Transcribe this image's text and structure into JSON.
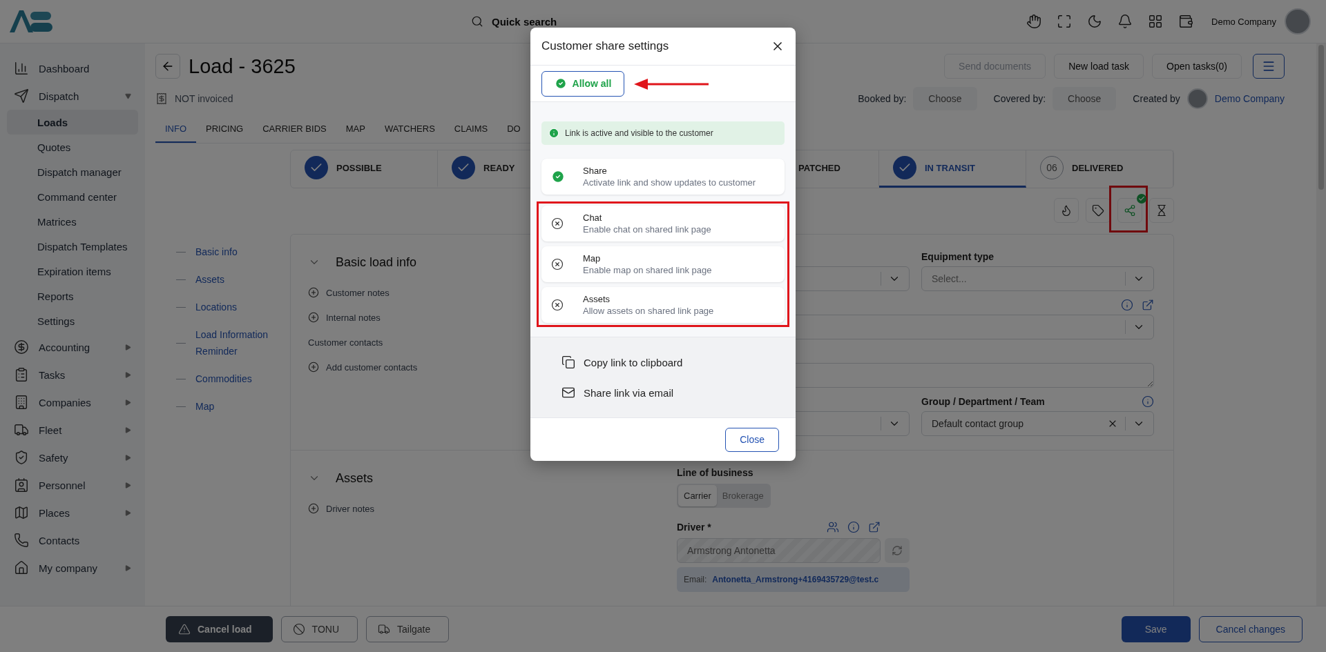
{
  "header": {
    "search_placeholder": "Quick search",
    "company": "Demo Company"
  },
  "sidebar": {
    "items": [
      {
        "label": "Dashboard",
        "kind": "link"
      },
      {
        "label": "Dispatch",
        "kind": "menu",
        "expanded": true,
        "children": [
          {
            "label": "Loads",
            "selected": true
          },
          {
            "label": "Quotes",
            "selected": false
          },
          {
            "label": "Dispatch manager",
            "selected": false
          },
          {
            "label": "Command center",
            "selected": false
          },
          {
            "label": "Matrices",
            "selected": false
          },
          {
            "label": "Dispatch Templates",
            "selected": false
          },
          {
            "label": "Expiration items",
            "selected": false
          },
          {
            "label": "Reports",
            "selected": false
          },
          {
            "label": "Settings",
            "selected": false
          }
        ]
      },
      {
        "label": "Accounting",
        "kind": "menu",
        "expanded": false
      },
      {
        "label": "Tasks",
        "kind": "menu",
        "expanded": false
      },
      {
        "label": "Companies",
        "kind": "menu",
        "expanded": false
      },
      {
        "label": "Fleet",
        "kind": "menu",
        "expanded": false
      },
      {
        "label": "Safety",
        "kind": "menu",
        "expanded": false
      },
      {
        "label": "Personnel",
        "kind": "menu",
        "expanded": false
      },
      {
        "label": "Places",
        "kind": "menu",
        "expanded": false
      },
      {
        "label": "Contacts",
        "kind": "link"
      },
      {
        "label": "My company",
        "kind": "menu",
        "expanded": false
      }
    ]
  },
  "page": {
    "title": "Load - 3625",
    "actions": [
      {
        "label": "Send documents",
        "disabled": true
      },
      {
        "label": "New load task",
        "disabled": false
      },
      {
        "label": "Open tasks(0)",
        "disabled": false
      }
    ],
    "invoice_status": "NOT invoiced",
    "booked_by": {
      "label": "Booked by:",
      "value": "Choose"
    },
    "covered_by": {
      "label": "Covered by:",
      "value": "Choose"
    },
    "created_by": {
      "label": "Created by",
      "name": "Demo Company"
    }
  },
  "tabs": [
    {
      "label": "INFO",
      "selected": true
    },
    {
      "label": "PRICING",
      "selected": false
    },
    {
      "label": "CARRIER BIDS",
      "selected": false
    },
    {
      "label": "MAP",
      "selected": false
    },
    {
      "label": "WATCHERS",
      "selected": false
    },
    {
      "label": "CLAIMS",
      "selected": false
    },
    {
      "label": "DO",
      "selected": false
    }
  ],
  "steps": [
    {
      "label": "POSSIBLE",
      "kind": "done",
      "selected": false
    },
    {
      "label": "READY",
      "kind": "done",
      "selected": false
    },
    {
      "label": "PATCHED",
      "kind": "covered",
      "selected": false
    },
    {
      "label": "IN TRANSIT",
      "kind": "done",
      "selected": true
    },
    {
      "label": "DELIVERED",
      "kind": "number",
      "number": "06",
      "selected": false
    }
  ],
  "quick_actions": {
    "share_active": true,
    "share_highlighted": true
  },
  "anchors": [
    "Basic info",
    "Assets",
    "Locations",
    "Load Information Reminder",
    "Commodities",
    "Map"
  ],
  "basic_info": {
    "title": "Basic load info",
    "notes": [
      "Customer notes",
      "Internal notes"
    ],
    "contacts_label": "Customer contacts",
    "add_contacts": "Add customer contacts",
    "equipment_label": "Equipment type",
    "equipment_placeholder": "Select...",
    "group_label": "Group / Department / Team",
    "group_value": "Default contact group"
  },
  "assets": {
    "title": "Assets",
    "driver_notes": "Driver notes",
    "line_of_business": {
      "label": "Line of business",
      "options": [
        {
          "label": "Carrier",
          "selected": true
        },
        {
          "label": "Brokerage",
          "selected": false
        }
      ]
    },
    "driver_label": "Driver *",
    "driver_value": "Armstrong Antonetta",
    "email_label": "Email:",
    "email": "Antonetta_Armstrong+4169435729@test.c"
  },
  "bottom": {
    "left": [
      {
        "label": "Cancel load",
        "kind": "dark"
      },
      {
        "label": "TONU",
        "kind": "outline"
      },
      {
        "label": "Tailgate",
        "kind": "outline"
      }
    ],
    "right": [
      {
        "label": "Save",
        "kind": "primary"
      },
      {
        "label": "Cancel changes",
        "kind": "outline-blue"
      }
    ]
  },
  "dialog": {
    "title": "Customer share settings",
    "allow_all": {
      "label": "Allow all",
      "arrow": true
    },
    "banner": "Link is active and visible to the customer",
    "options": [
      {
        "title": "Share",
        "description": "Activate link and show updates to customer",
        "on": true,
        "highlighted": false
      },
      {
        "title": "Chat",
        "description": "Enable chat on shared link page",
        "on": false,
        "highlighted": true
      },
      {
        "title": "Map",
        "description": "Enable map on shared link page",
        "on": false,
        "highlighted": true
      },
      {
        "title": "Assets",
        "description": "Allow assets on shared link page",
        "on": false,
        "highlighted": true
      }
    ],
    "links": [
      "Copy link to clipboard",
      "Share link via email"
    ],
    "close": "Close"
  }
}
